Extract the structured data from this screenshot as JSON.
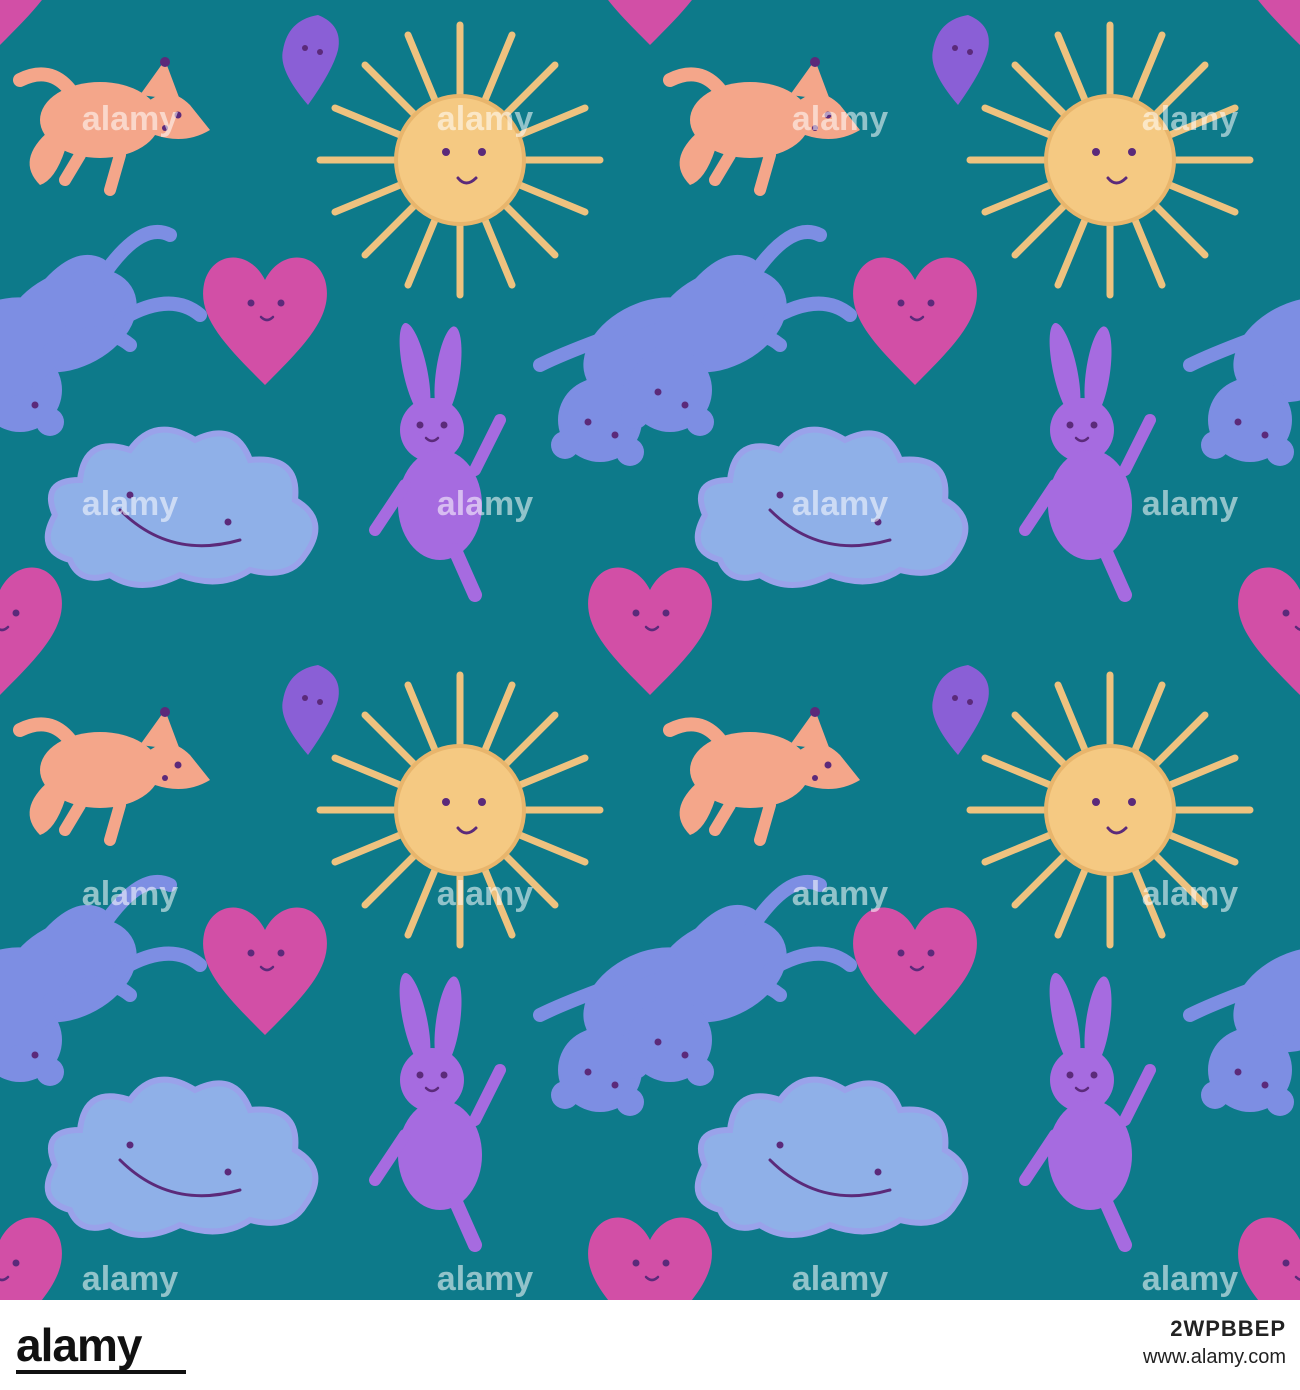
{
  "artwork": {
    "background_color": "#0d7a8a",
    "motif_colors": {
      "sun": "#f5c982",
      "sun_rays": "#eec27f",
      "fox": "#f4a68a",
      "heart": "#d24fa6",
      "bunny": "#a66be0",
      "bear": "#7d8ee3",
      "cloud": "#8fb0e8",
      "drop": "#8a5fd6",
      "face_ink": "#5b2a7a"
    },
    "motifs": [
      "sun",
      "fox",
      "heart",
      "bunny",
      "bear",
      "cloud",
      "raindrop"
    ],
    "watermark_text": "alamy"
  },
  "footer": {
    "logo_text": "alamy",
    "image_id": "2WPBBEP",
    "url": "www.alamy.com"
  }
}
